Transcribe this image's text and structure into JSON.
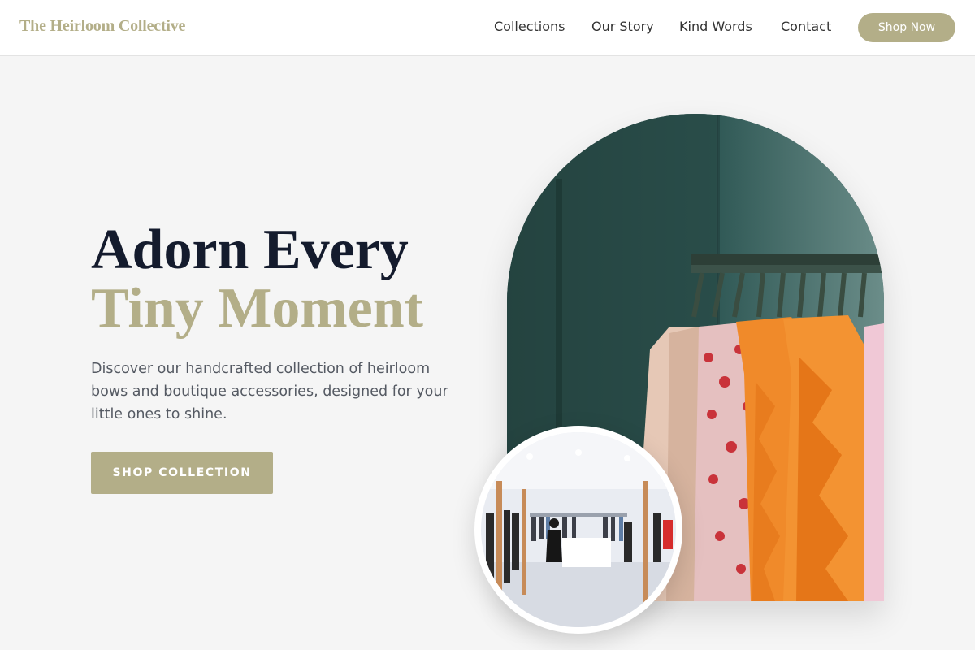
{
  "brand": {
    "name": "The Heirloom Collective"
  },
  "nav": {
    "links": [
      "Collections",
      "Our Story",
      "Kind Words",
      "Contact"
    ],
    "cta": "Shop Now"
  },
  "hero": {
    "title_line1": "Adorn Every",
    "title_line2": "Tiny Moment",
    "description": "Discover our handcrafted collection of heirloom bows and boutique accessories, designed for your little ones to shine.",
    "button": "SHOP COLLECTION"
  },
  "colors": {
    "accent": "#b3ae88",
    "heading": "#141b2d",
    "body_text": "#555a63",
    "background": "#f5f5f5"
  },
  "images": {
    "arch": "clothing-rack-photo",
    "circle": "boutique-interior-photo"
  }
}
